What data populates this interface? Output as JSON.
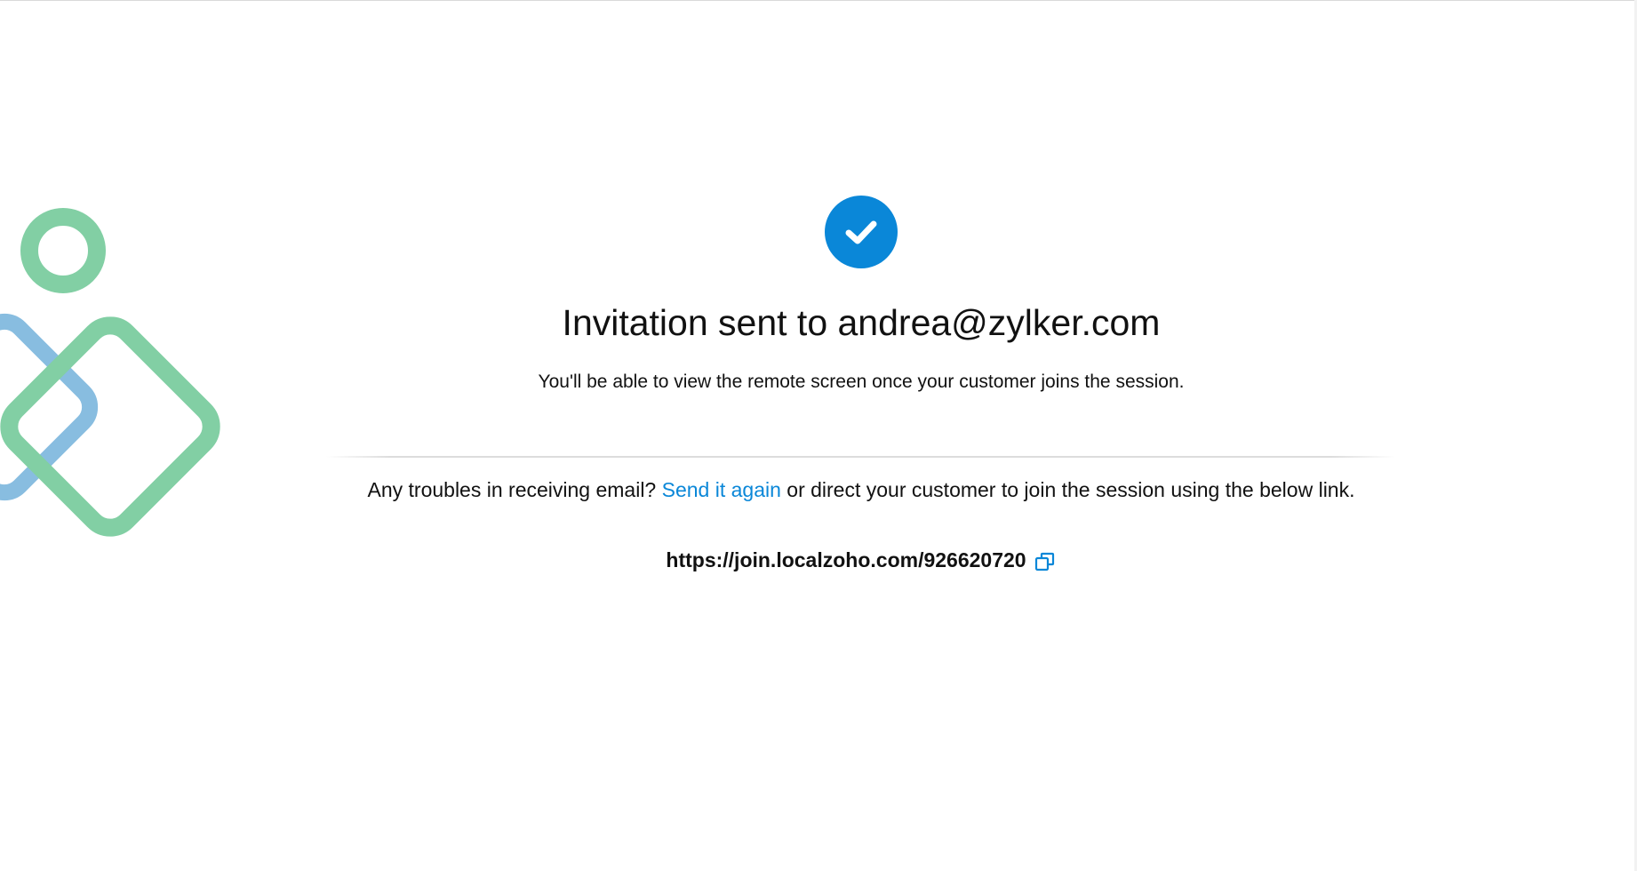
{
  "confirmation": {
    "title": "Invitation sent to andrea@zylker.com",
    "subtitle": "You'll be able to view the remote screen once your customer joins the session."
  },
  "help": {
    "prefix": "Any troubles in receiving email?",
    "resend_link_label": "Send it again",
    "suffix": "or direct your customer to join the session using the below link."
  },
  "join": {
    "link": "https://join.localzoho.com/926620720",
    "copy_icon": "copy-icon"
  },
  "icons": {
    "success": "check-circle-icon",
    "decoration": "decorative-shapes"
  },
  "colors": {
    "accent": "#0a87d8",
    "decor_green": "#82cfa4",
    "decor_blue": "#88bde0",
    "text": "#111111"
  }
}
